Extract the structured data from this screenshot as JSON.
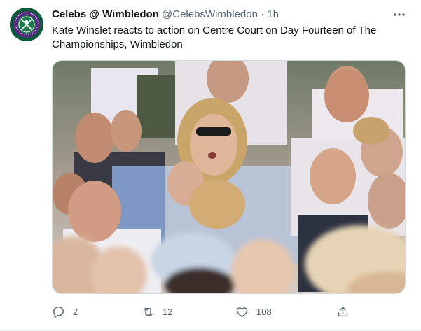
{
  "tweet": {
    "author_name": "Celebs @ Wimbledon",
    "author_handle": "@CelebsWimbledon",
    "separator": "·",
    "time": "1h",
    "text": "Kate Winslet reacts to action on Centre Court on Day Fourteen of The Championships, Wimbledon",
    "avatar_text": "THE CHAMPIONSHIPS · WIMBLEDON",
    "media_description_icon": "crowd-photo"
  },
  "actions": {
    "reply_count": "2",
    "retweet_count": "12",
    "like_count": "108"
  },
  "colors": {
    "text_primary": "#0f1419",
    "text_secondary": "#536471",
    "wimbledon_green": "#0b5a3b",
    "wimbledon_purple": "#5b2c83"
  },
  "icons": [
    "more-icon",
    "reply-icon",
    "retweet-icon",
    "like-icon",
    "share-icon"
  ]
}
